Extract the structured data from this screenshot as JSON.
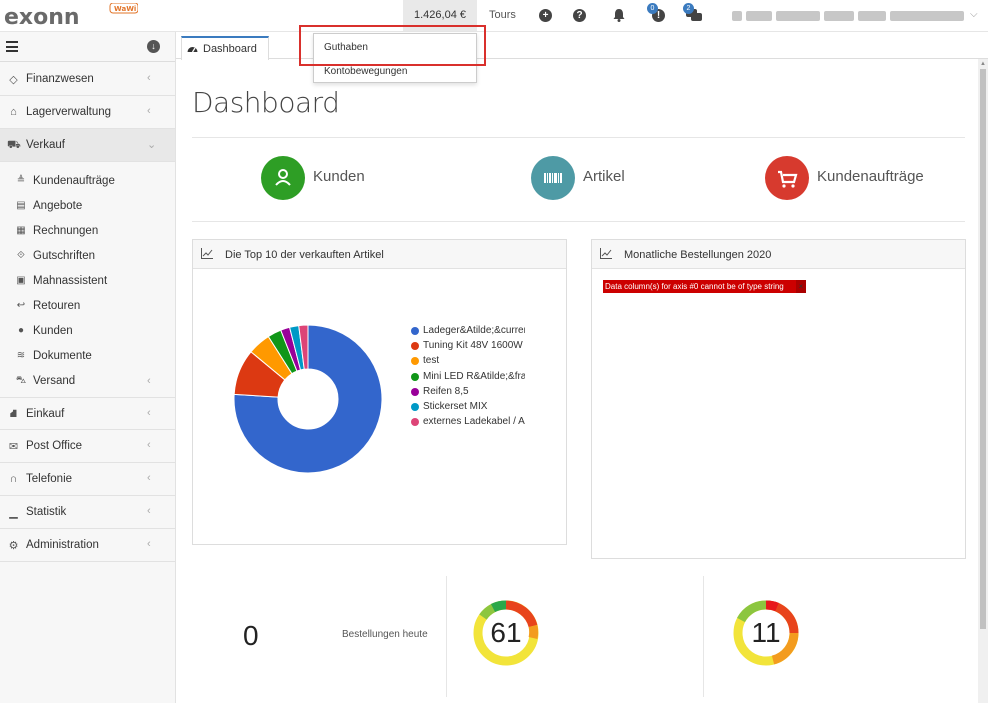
{
  "topbar": {
    "logo_text": "exonn",
    "logo_badge": "WaWi",
    "balance": "1.426,04 €",
    "tours": "Tours",
    "notif_badge_1": "0",
    "notif_badge_2": "2"
  },
  "sidebar": {
    "items": [
      {
        "label": "Finanzwesen"
      },
      {
        "label": "Lagerverwaltung"
      },
      {
        "label": "Verkauf"
      },
      {
        "label": "Einkauf"
      },
      {
        "label": "Post Office"
      },
      {
        "label": "Telefonie"
      },
      {
        "label": "Statistik"
      },
      {
        "label": "Administration"
      }
    ],
    "sub": [
      {
        "label": "Kundenaufträge"
      },
      {
        "label": "Angebote"
      },
      {
        "label": "Rechnungen"
      },
      {
        "label": "Gutschriften"
      },
      {
        "label": "Mahnassistent"
      },
      {
        "label": "Retouren"
      },
      {
        "label": "Kunden"
      },
      {
        "label": "Dokumente"
      },
      {
        "label": "Versand"
      }
    ]
  },
  "tabs": [
    {
      "label": "Dashboard"
    }
  ],
  "dropdown": {
    "items": [
      {
        "label": "Guthaben"
      },
      {
        "label": "Kontobewegungen"
      }
    ]
  },
  "main": {
    "title": "Dashboard",
    "quick": [
      {
        "label": "Kunden",
        "color": "#2e9e25"
      },
      {
        "label": "Artikel",
        "color": "#4e9aa5"
      },
      {
        "label": "Kundenaufträge",
        "color": "#d73a2e"
      }
    ],
    "panel_top10": {
      "title": "Die Top 10 der verkauften Artikel"
    },
    "panel_monthly": {
      "title": "Monatliche Bestellungen 2020",
      "error": "Data column(s) for axis #0 cannot be of type string",
      "error_close": "×"
    },
    "kpi": {
      "orders_today": "0",
      "orders_today_label": "Bestellungen heute",
      "gauge1": "61",
      "gauge2": "11"
    }
  },
  "chart_data": {
    "type": "pie",
    "donut": true,
    "legend_position": "right",
    "labels": [
      "Ladeger&Atilde;&curren",
      "Tuning Kit 48V 1600W",
      "test",
      "Mini LED R&Atilde;&fra",
      "Reifen 8,5",
      "Stickerset MIX",
      "externes Ladekabel / A"
    ],
    "values": [
      76,
      10,
      5,
      3,
      2,
      2,
      2
    ],
    "colors": [
      "#3366cc",
      "#dc3912",
      "#ff9900",
      "#109618",
      "#990099",
      "#0099c6",
      "#dd4477"
    ]
  }
}
